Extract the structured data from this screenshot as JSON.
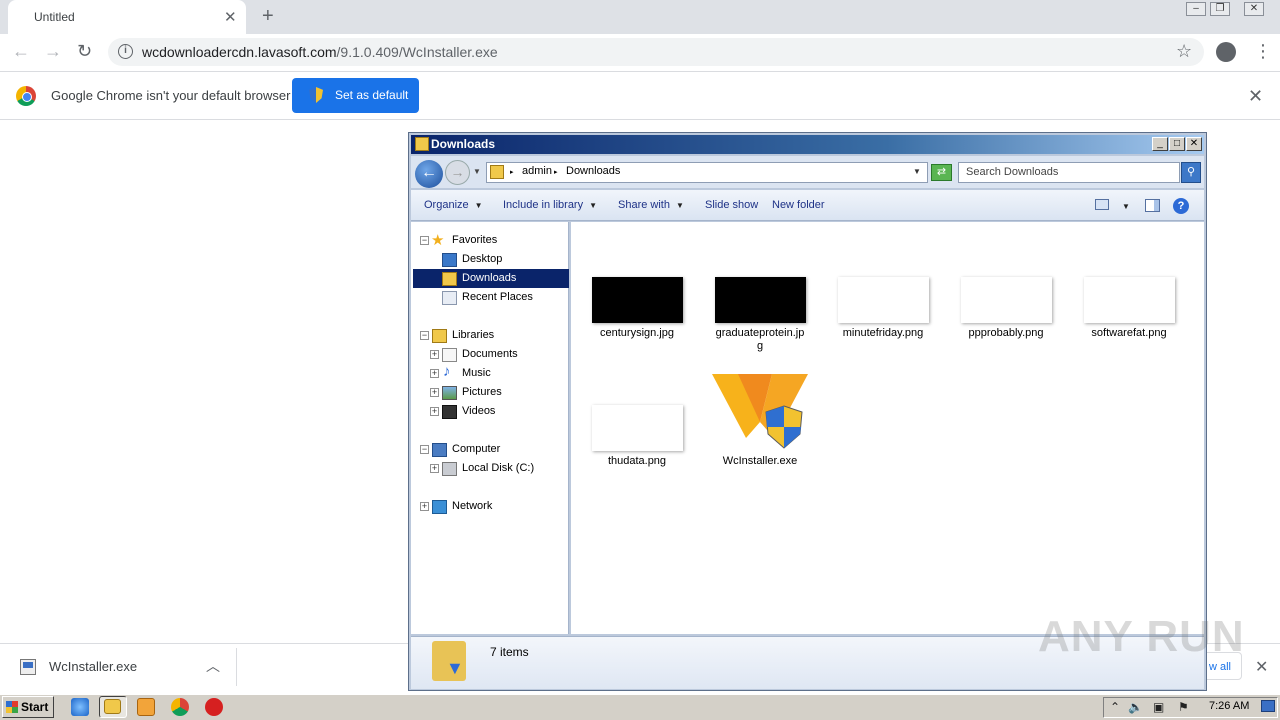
{
  "browser": {
    "tab_title": "Untitled",
    "url_host": "wcdownloadercdn.lavasoft.com",
    "url_path": "/9.1.0.409/WcInstaller.exe",
    "infobar_text": "Google Chrome isn't your default browser",
    "set_default_label": "Set as default",
    "accent": "#1a73e8"
  },
  "download_shelf": {
    "file_name": "WcInstaller.exe",
    "show_all_partial": "w all"
  },
  "explorer": {
    "title": "Downloads",
    "breadcrumb": [
      "admin",
      "Downloads"
    ],
    "search_placeholder": "Search Downloads",
    "commands": {
      "organize": "Organize",
      "include_in_library": "Include in library",
      "share_with": "Share with",
      "slide_show": "Slide show",
      "new_folder": "New folder"
    },
    "nav": {
      "favorites": "Favorites",
      "desktop": "Desktop",
      "downloads": "Downloads",
      "recent_places": "Recent Places",
      "libraries": "Libraries",
      "documents": "Documents",
      "music": "Music",
      "pictures": "Pictures",
      "videos": "Videos",
      "computer": "Computer",
      "local_disk": "Local Disk (C:)",
      "network": "Network"
    },
    "files": [
      {
        "name": "centurysign.jpg",
        "thumb": "#000000"
      },
      {
        "name": "graduateprotein.jpg",
        "name_line1": "graduateprotein.jp",
        "name_line2": "g",
        "thumb": "#000000"
      },
      {
        "name": "minutefriday.png",
        "thumb": "#ffffff"
      },
      {
        "name": "ppprobably.png",
        "thumb": "#ffffff"
      },
      {
        "name": "softwarefat.png",
        "thumb": "#ffffff"
      },
      {
        "name": "thudata.png",
        "thumb": "#ffffff"
      },
      {
        "name": "WcInstaller.exe",
        "icon": "wc-installer-icon"
      }
    ],
    "item_count": "7 items"
  },
  "watermark": "ANY RUN",
  "taskbar": {
    "start_label": "Start",
    "clock": "7:26 AM"
  }
}
